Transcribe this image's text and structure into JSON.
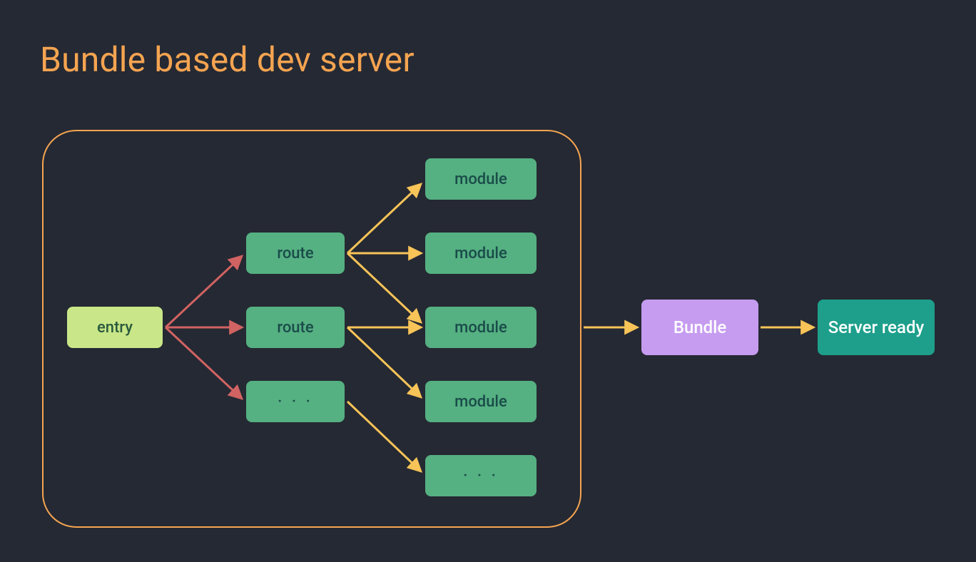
{
  "title": "Bundle based dev server",
  "nodes": {
    "entry": "entry",
    "route1": "route",
    "route2": "route",
    "dots1": "· · ·",
    "module1": "module",
    "module2": "module",
    "module3": "module",
    "module4": "module",
    "dots2": "· · ·",
    "bundle": "Bundle",
    "server": "Server ready"
  },
  "colors": {
    "background": "#252933",
    "accent": "#f5a451",
    "entryBg": "#c9e788",
    "greenBg": "#55b082",
    "bundleBg": "#c69cf0",
    "serverBg": "#1d9f8b",
    "redArrow": "#d16362",
    "yellowArrow": "#f8c458"
  }
}
